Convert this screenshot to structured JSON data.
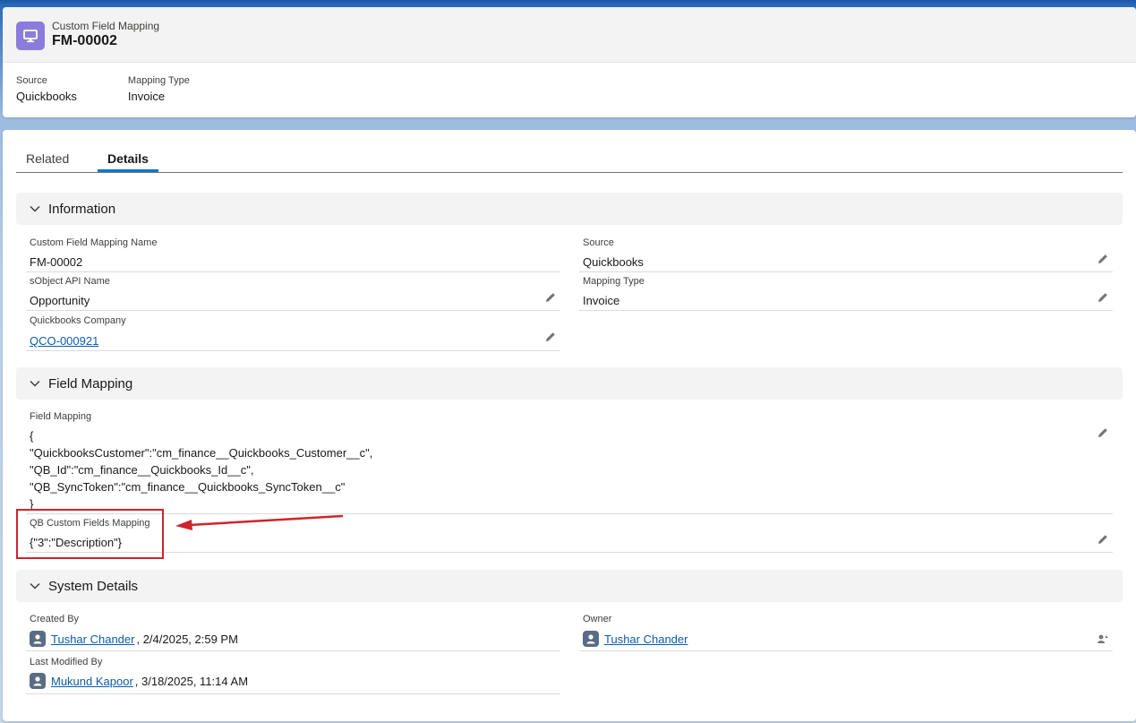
{
  "header": {
    "object_type": "Custom Field Mapping",
    "record_name": "FM-00002",
    "highlights": [
      {
        "label": "Source",
        "value": "Quickbooks"
      },
      {
        "label": "Mapping Type",
        "value": "Invoice"
      }
    ]
  },
  "tabs": [
    {
      "label": "Related",
      "active": false
    },
    {
      "label": "Details",
      "active": true
    }
  ],
  "sections": {
    "information": {
      "title": "Information",
      "fields": {
        "name": {
          "label": "Custom Field Mapping Name",
          "value": "FM-00002"
        },
        "source": {
          "label": "Source",
          "value": "Quickbooks"
        },
        "sobject": {
          "label": "sObject API Name",
          "value": "Opportunity"
        },
        "mapping_type": {
          "label": "Mapping Type",
          "value": "Invoice"
        },
        "company": {
          "label": "Quickbooks Company",
          "value": "QCO-000921"
        }
      }
    },
    "field_mapping": {
      "title": "Field Mapping",
      "fields": {
        "field_mapping": {
          "label": "Field Mapping",
          "lines": [
            "{",
            "\"QuickbooksCustomer\":\"cm_finance__Quickbooks_Customer__c\",",
            "\"QB_Id\":\"cm_finance__Quickbooks_Id__c\",",
            "\"QB_SyncToken\":\"cm_finance__Quickbooks_SyncToken__c\"",
            "}"
          ]
        },
        "qb_custom": {
          "label": "QB Custom Fields Mapping",
          "value": "{\"3\":\"Description\"}"
        }
      }
    },
    "system_details": {
      "title": "System Details",
      "fields": {
        "created_by": {
          "label": "Created By",
          "user": "Tushar Chander",
          "date": ", 2/4/2025, 2:59 PM"
        },
        "owner": {
          "label": "Owner",
          "user": "Tushar Chander"
        },
        "modified_by": {
          "label": "Last Modified By",
          "user": "Mukund Kapoor",
          "date": ", 3/18/2025, 11:14 AM"
        }
      }
    }
  },
  "colors": {
    "accent": "#0176d3",
    "link": "#0b5cab",
    "object_icon": "#8b7cdb",
    "annotation": "#d0242b"
  },
  "icons": {
    "object": "desktop-icon",
    "edit": "pencil-icon",
    "collapse": "chevron-down-icon",
    "user": "user-avatar-icon",
    "change_owner": "change-owner-icon"
  }
}
